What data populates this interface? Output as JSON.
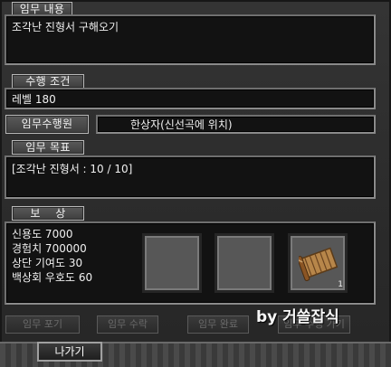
{
  "sections": {
    "content_label": "임무 내용",
    "content_text": "조각난 진형서 구해오기",
    "condition_label": "수행 조건",
    "condition_text": "레벨 180",
    "npc_label": "임무수행원",
    "npc_text": "한상자(신선곡에 위치)",
    "goal_label": "임무 목표",
    "goal_text": "[조각난 진형서 : 10 / 10]",
    "reward_label": "보    상",
    "rewards": [
      "신용도 7000",
      "경험치 700000",
      "상단 기여도 30",
      "백상회 우호도 60"
    ]
  },
  "reward_slots": [
    {
      "item": "",
      "count": ""
    },
    {
      "item": "",
      "count": ""
    },
    {
      "item": "scroll-item-icon",
      "count": "1"
    }
  ],
  "buttons": {
    "giveup": "임무 포기",
    "accept": "임무 수락",
    "complete": "임무 완료",
    "fourth": "임무 수행 가기",
    "exit": "나가기"
  },
  "watermark": "by 거쓸잡식"
}
